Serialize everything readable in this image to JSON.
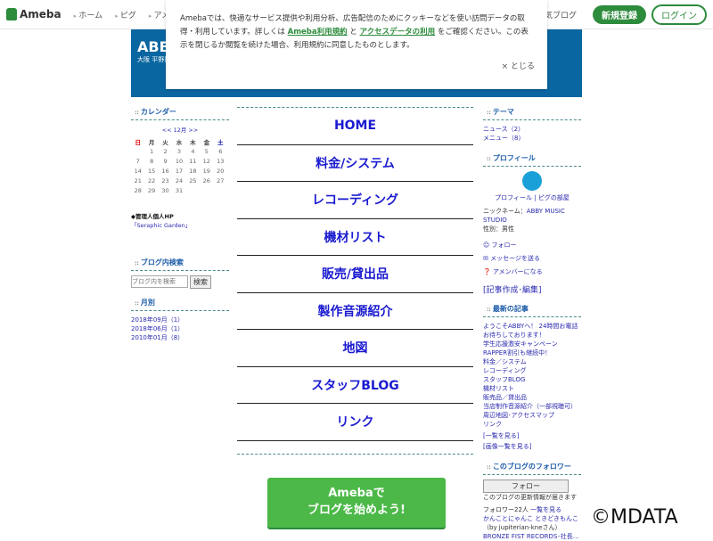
{
  "topbar": {
    "logo": "Ameba",
    "nav": [
      "ホーム",
      "ピグ",
      "アメブロ"
    ],
    "right_nav": "人気ブログ",
    "register": "新規登録",
    "login": "ログイン"
  },
  "header": {
    "title": "ABBY",
    "subtitle": "大阪 平野区"
  },
  "cookie": {
    "text1": "Amebaでは、快適なサービス提供や利用分析、広告配信のためにクッキーなどを使い訪問データの取得・利用しています。詳しくは ",
    "link1": "Ameba利用規約",
    "and": " と ",
    "link2": "アクセスデータの利用",
    "text2": " をご確認ください。この表示を閉じるか閲覧を続けた場合、利用規約に同意したものとします。",
    "close": "× とじる"
  },
  "left": {
    "calendar_title": "カレンダー",
    "month_nav": "<< 12月 >>",
    "weekdays": [
      "日",
      "月",
      "火",
      "水",
      "木",
      "金",
      "土"
    ],
    "weeks": [
      [
        "",
        "1",
        "2",
        "3",
        "4",
        "5",
        "6"
      ],
      [
        "7",
        "8",
        "9",
        "10",
        "11",
        "12",
        "13"
      ],
      [
        "14",
        "15",
        "16",
        "17",
        "18",
        "19",
        "20"
      ],
      [
        "21",
        "22",
        "23",
        "24",
        "25",
        "26",
        "27"
      ],
      [
        "28",
        "29",
        "30",
        "31",
        "",
        "",
        ""
      ]
    ],
    "hp_label": "◆管理人個人HP",
    "hp_link": "「Seraphic Garden」",
    "search_title": "ブログ内検索",
    "search_placeholder": "ブログ内を検索",
    "search_button": "検索",
    "monthly_title": "月別",
    "monthly": [
      "2018年09月（1）",
      "2018年06月（1）",
      "2010年01月（8）"
    ]
  },
  "menu": [
    "HOME",
    "料金/システム",
    "レコーディング",
    "機材リスト",
    "販売/貸出品",
    "製作音源紹介",
    "地図",
    "スタッフBLOG",
    "リンク"
  ],
  "banner": {
    "line1": "Amebaで",
    "line2": "ブログを始めよう!"
  },
  "right": {
    "theme_title": "テーマ",
    "themes": [
      "ニュース（2）",
      "メニュー（8）"
    ],
    "profile_title": "プロフィール",
    "profile_links": "プロフィール | ピグの部屋",
    "nickname_label": "ニックネーム：",
    "nickname": "ABBY MUSIC STUDIO",
    "gender": "性別：男性",
    "follow": "フォロー",
    "message": "メッセージを送る",
    "amember": "アメンバーになる",
    "edit": "[記事作成･編集]",
    "latest_title": "最新の記事",
    "latest": [
      "ようこそABBYへ！ 24時間お電話お待ちしております！",
      "学生応援激安キャンペーン",
      "RAPPER割引も継続中！",
      "料金／システム",
      "レコーディング",
      "スタッフBLOG",
      "機材リスト",
      "販売品／貸出品",
      "当店制作音源紹介（一部視聴可）",
      "周辺地図･アクセスマップ",
      "リンク"
    ],
    "list_all": "[一覧を見る]",
    "image_list": "[画像一覧を見る]",
    "followers_title": "このブログのフォロワー",
    "follow_button": "フォロー",
    "follow_note": "このブログの更新情報が届きます",
    "follower_count": "フォロワー22人",
    "follower_list": "一覧を見る",
    "follower1": "かんことにゃんこ ときどきもんこ",
    "follower1_by": "（by jupiterian-kneさん）",
    "follower2": "BRONZE FIST RECORDS･社長…"
  },
  "watermark": "©MDATA"
}
